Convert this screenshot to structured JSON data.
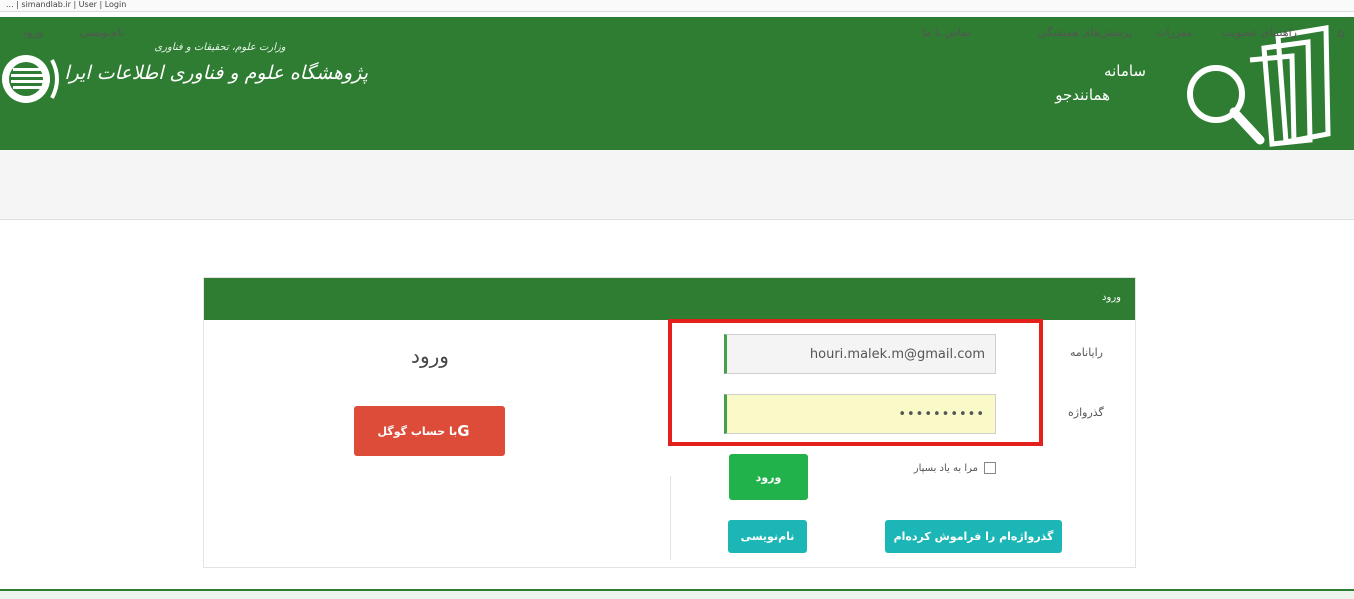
{
  "browser": {
    "breadcrumb": "... | simandlab.ir | User | Login"
  },
  "header": {
    "ministry": "وزارت علوم، تحقیقات و فناوری",
    "institute": "پژوهشگاه علوم و فناوری اطلاعات ایران (ایرانداک)",
    "system_label": "سامانه",
    "system_name": "همانندجو",
    "colors": {
      "header_bg": "#2e7d32"
    }
  },
  "nav": {
    "home_icon": "home-icon",
    "items": [
      "راهنمای عضویت",
      "مقررات",
      "پرسش‌های همیشگی",
      "تماس با ما"
    ],
    "signup": "نام‌نویسی",
    "login": "ورود"
  },
  "panel": {
    "title": "ورود",
    "username_label": "رایانامه",
    "username_value": "houri.malek.m@gmail.com",
    "password_label": "گذرواژه",
    "password_value": "••••••••••",
    "remember_label": "مرا به یاد بسپار",
    "login_button": "ورود",
    "forgot_button": "گذرواژه‌ام را فراموش کرده‌ام",
    "signup_button": "نام‌نویسی",
    "alt_title": "ورود",
    "google_button": "با حساب گوگل",
    "google_icon": "G"
  }
}
